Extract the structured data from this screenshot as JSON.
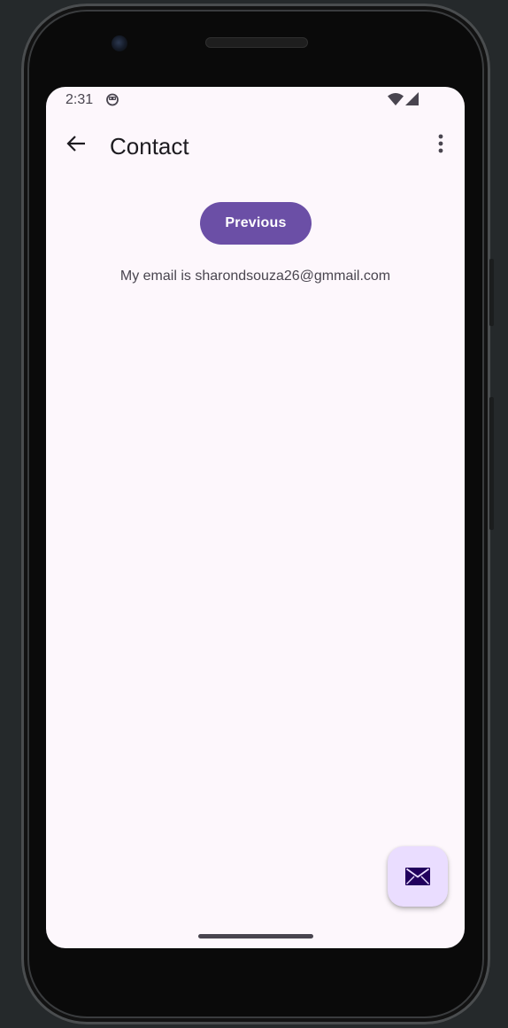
{
  "status_bar": {
    "time": "2:31",
    "app_icon": "android-notification-icon",
    "wifi_icon": "wifi-icon",
    "signal_icon": "cell-signal-icon"
  },
  "app_bar": {
    "title": "Contact",
    "back_icon": "arrow-back-icon",
    "overflow_icon": "more-vert-icon"
  },
  "main": {
    "previous_button_label": "Previous",
    "email_text": "My email is sharondsouza26@gmmail.com"
  },
  "fab": {
    "icon": "email-icon"
  },
  "colors": {
    "background": "#fdf7fc",
    "primary": "#6b4fa6",
    "fab_container": "#eaddff",
    "fab_icon": "#21005d"
  }
}
